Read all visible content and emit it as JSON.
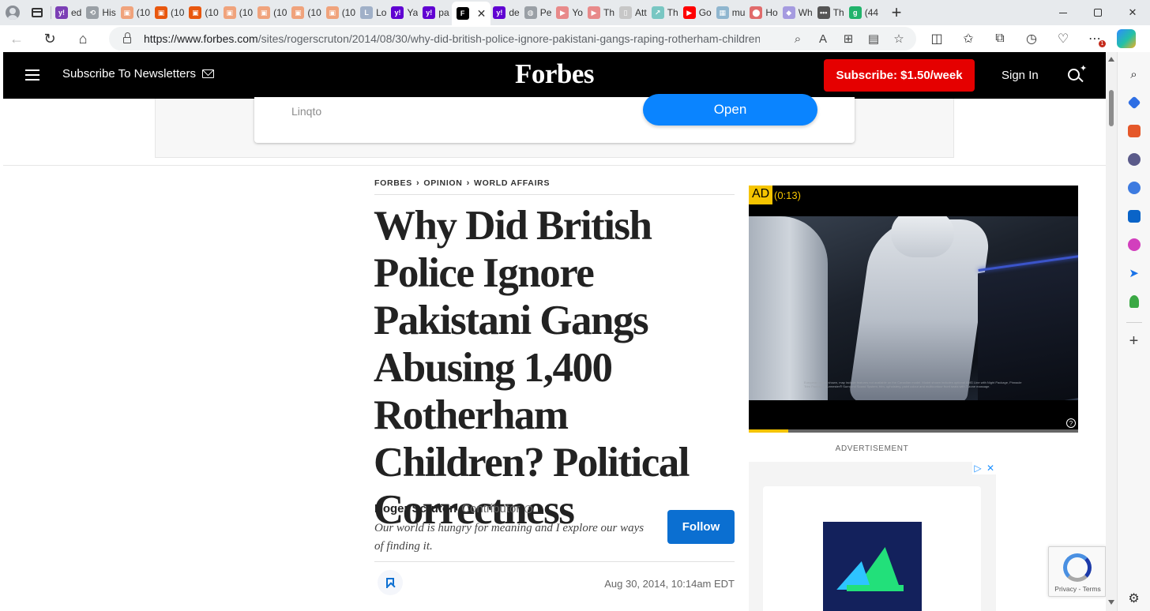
{
  "browser": {
    "tabs": [
      {
        "label": "ed",
        "fav_color": "#7b3fb5",
        "fav_glyph": "y!"
      },
      {
        "label": "His",
        "fav_color": "#9aa0a6",
        "fav_glyph": "⟲"
      },
      {
        "label": "(10",
        "fav_color": "#f0a37c",
        "fav_glyph": "▣"
      },
      {
        "label": "(10",
        "fav_color": "#e8570e",
        "fav_glyph": "▣"
      },
      {
        "label": "(10",
        "fav_color": "#e8570e",
        "fav_glyph": "▣"
      },
      {
        "label": "(10",
        "fav_color": "#f0a37c",
        "fav_glyph": "▣"
      },
      {
        "label": "(10",
        "fav_color": "#f0a37c",
        "fav_glyph": "▣"
      },
      {
        "label": "(10",
        "fav_color": "#f0a37c",
        "fav_glyph": "▣"
      },
      {
        "label": "(10",
        "fav_color": "#f0a37c",
        "fav_glyph": "▣"
      },
      {
        "label": "Lo",
        "fav_color": "#a0b0c8",
        "fav_glyph": "L"
      },
      {
        "label": "Ya",
        "fav_color": "#6001d2",
        "fav_glyph": "y!"
      },
      {
        "label": "pa",
        "fav_color": "#6001d2",
        "fav_glyph": "y!"
      },
      {
        "label": "",
        "fav_color": "#000000",
        "fav_glyph": "F",
        "active": true
      },
      {
        "label": "de",
        "fav_color": "#6001d2",
        "fav_glyph": "y!"
      },
      {
        "label": "Pe",
        "fav_color": "#9aa0a6",
        "fav_glyph": "◍"
      },
      {
        "label": "Yo",
        "fav_color": "#e88a8a",
        "fav_glyph": "▶"
      },
      {
        "label": "Th",
        "fav_color": "#e88a8a",
        "fav_glyph": "▶"
      },
      {
        "label": "Att",
        "fav_color": "#c7c7c7",
        "fav_glyph": "▯"
      },
      {
        "label": "Th",
        "fav_color": "#79c7c3",
        "fav_glyph": "↗"
      },
      {
        "label": "Go",
        "fav_color": "#ff0000",
        "fav_glyph": "▶"
      },
      {
        "label": "mu",
        "fav_color": "#8fb6cf",
        "fav_glyph": "▦"
      },
      {
        "label": "Ho",
        "fav_color": "#e06b6b",
        "fav_glyph": "⬤"
      },
      {
        "label": "Wh",
        "fav_color": "#a59be0",
        "fav_glyph": "◆"
      },
      {
        "label": "Th",
        "fav_color": "#555555",
        "fav_glyph": "•••"
      },
      {
        "label": "(44",
        "fav_color": "#21b36b",
        "fav_glyph": "g"
      }
    ],
    "url_host": "https://www.forbes.com",
    "url_path": "/sites/rogerscruton/2014/08/30/why-did-british-police-ignore-pakistani-gangs-raping-rotherham-children-...",
    "notification_count": "1"
  },
  "header": {
    "newsletter_label": "Subscribe To Newsletters",
    "logo": "Forbes",
    "subscribe_label": "Subscribe: $1.50/week",
    "signin_label": "Sign In"
  },
  "top_ad": {
    "brand": "Linqto",
    "cta": "Open"
  },
  "article": {
    "breadcrumb": [
      "FORBES",
      "OPINION",
      "WORLD AFFAIRS"
    ],
    "headline": "Why Did British Police Ignore Pakistani Gangs Abusing 1,400 Rotherham Children? Political Correctness",
    "author": "Roger Scruton",
    "author_role": "Contributor",
    "author_bio": "Our world is hungry for meaning and I explore our ways of finding it.",
    "follow_label": "Follow",
    "date": "Aug 30, 2014, 10:14am EDT"
  },
  "video_ad": {
    "badge": "AD",
    "timer": "(0:13)",
    "progress": 0.12,
    "fineprint": "European model shown, may include features not available on the Canadian model. Model shown includes optional AMG Line with Night Package, Pinnacle Trim Package, Burmester® Surround Sound System, trim, upholstery, paint colour and multicontour front seats with 7-zone massage."
  },
  "advertisement_label": "ADVERTISEMENT",
  "recaptcha": {
    "links": "Privacy - Terms"
  }
}
